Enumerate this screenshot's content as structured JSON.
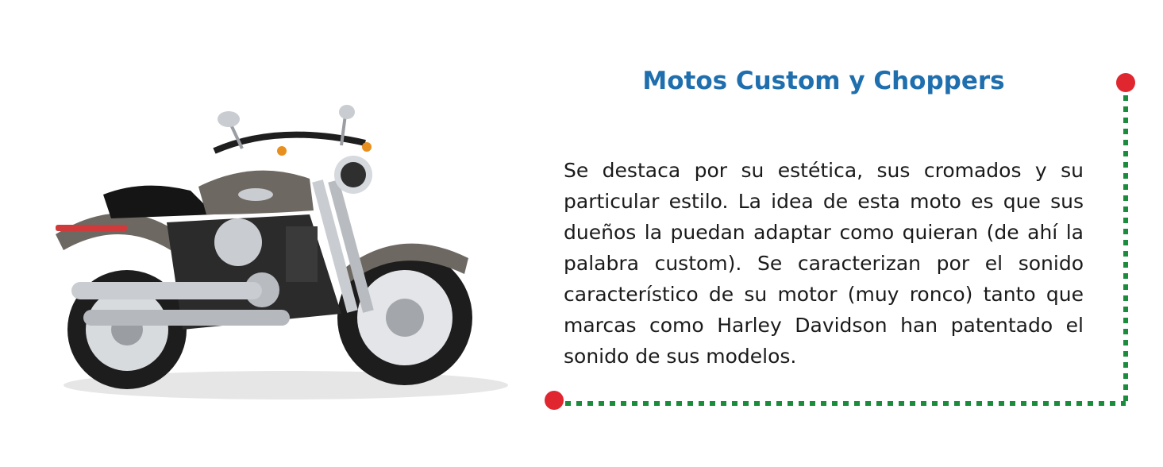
{
  "section": {
    "title": "Motos Custom y Choppers",
    "body": "Se destaca por su estética, sus cromados y su particular estilo. La idea de esta moto es que sus dueños la puedan adaptar como quieran (de ahí la palabra custom). Se caracterizan por el sonido característico de su motor (muy ronco) tanto que marcas como Harley Davidson han patentado el sonido de sus modelos."
  },
  "image": {
    "subject": "motorcycle-photo"
  },
  "colors": {
    "title": "#1f6fae",
    "dot": "#e0262f",
    "dotted_line": "#1a8c3c",
    "tank": "#6e6862",
    "chrome": "#c9ccd0"
  }
}
